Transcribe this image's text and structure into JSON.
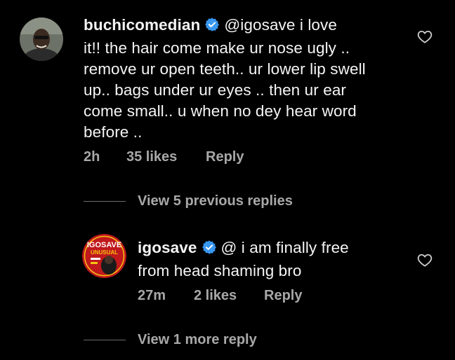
{
  "comments": [
    {
      "username": "buchicomedian",
      "text_lines": [
        "@igosave i love",
        "it!! the hair come make ur nose ugly ..",
        "remove ur open teeth.. ur lower lip swell",
        "up.. bags  under ur eyes .. then ur ear",
        "come small.. u when no dey hear word",
        "before .."
      ],
      "time": "2h",
      "likes": "35 likes",
      "reply_label": "Reply"
    },
    {
      "username": "igosave",
      "text_lines": [
        "@ i am finally free",
        "from head shaming bro"
      ],
      "time": "27m",
      "likes": "2 likes",
      "reply_label": "Reply",
      "avatar_text": {
        "title": "IGOSAVE",
        "subtitle": "UNUSUAL"
      }
    }
  ],
  "view_previous_replies": "View 5 previous replies",
  "view_more_reply": "View 1 more reply",
  "colors": {
    "background": "#000000",
    "text": "#f5f5f5",
    "muted": "#a8a8a8",
    "verified": "#3897f0",
    "igosave_red": "#c0181c",
    "igosave_yellow": "#f5c211"
  }
}
